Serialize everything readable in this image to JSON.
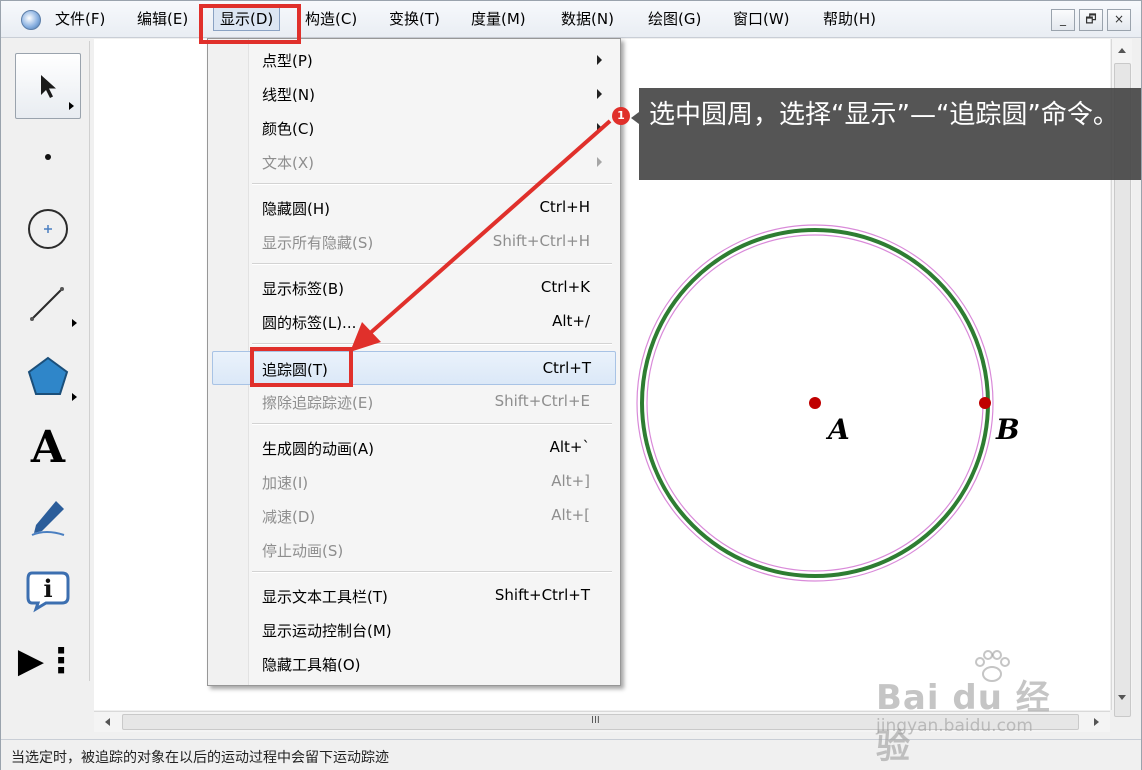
{
  "menubar": {
    "items": [
      "文件(F)",
      "编辑(E)",
      "显示(D)",
      "构造(C)",
      "变换(T)",
      "度量(M)",
      "数据(N)",
      "绘图(G)",
      "窗口(W)",
      "帮助(H)"
    ],
    "window_buttons": [
      "_",
      "🗗",
      "×"
    ]
  },
  "toolbox": {
    "tools": [
      "arrow-tool",
      "point-tool",
      "compass-tool",
      "straightedge-tool",
      "polygon-tool",
      "text-tool",
      "marker-tool",
      "information-tool",
      "custom-tool"
    ],
    "text_tool_glyph": "A",
    "info_tool_glyph": "i",
    "custom_tool_glyph": "▶⋮"
  },
  "dropdown": {
    "items": [
      {
        "label": "点型(P)",
        "shortcut": "",
        "submenu": true,
        "disabled": false
      },
      {
        "label": "线型(N)",
        "shortcut": "",
        "submenu": true,
        "disabled": false
      },
      {
        "label": "颜色(C)",
        "shortcut": "",
        "submenu": true,
        "disabled": false
      },
      {
        "label": "文本(X)",
        "shortcut": "",
        "submenu": true,
        "disabled": true
      },
      {
        "label": "隐藏圆(H)",
        "shortcut": "Ctrl+H",
        "submenu": false,
        "disabled": false
      },
      {
        "label": "显示所有隐藏(S)",
        "shortcut": "Shift+Ctrl+H",
        "submenu": false,
        "disabled": true
      },
      {
        "label": "显示标签(B)",
        "shortcut": "Ctrl+K",
        "submenu": false,
        "disabled": false
      },
      {
        "label": "圆的标签(L)...",
        "shortcut": "Alt+/",
        "submenu": false,
        "disabled": false
      },
      {
        "label": "追踪圆(T)",
        "shortcut": "Ctrl+T",
        "submenu": false,
        "disabled": false,
        "highlighted": true
      },
      {
        "label": "擦除追踪踪迹(E)",
        "shortcut": "Shift+Ctrl+E",
        "submenu": false,
        "disabled": true
      },
      {
        "label": "生成圆的动画(A)",
        "shortcut": "Alt+`",
        "submenu": false,
        "disabled": false
      },
      {
        "label": "加速(I)",
        "shortcut": "Alt+]",
        "submenu": false,
        "disabled": true
      },
      {
        "label": "减速(D)",
        "shortcut": "Alt+[",
        "submenu": false,
        "disabled": true
      },
      {
        "label": "停止动画(S)",
        "shortcut": "",
        "submenu": false,
        "disabled": true
      },
      {
        "label": "显示文本工具栏(T)",
        "shortcut": "Shift+Ctrl+T",
        "submenu": false,
        "disabled": false
      },
      {
        "label": "显示运动控制台(M)",
        "shortcut": "",
        "submenu": false,
        "disabled": false
      },
      {
        "label": "隐藏工具箱(O)",
        "shortcut": "",
        "submenu": false,
        "disabled": false
      }
    ]
  },
  "canvas": {
    "point_a_label": "A",
    "point_b_label": "B",
    "circle_color": "#2e7d32",
    "circle_trace_color": "#d98ad9",
    "point_color": "#c00000"
  },
  "callout": {
    "number": "1",
    "text": "选中圆周，选择“显示”—“追踪圆”命令。"
  },
  "hscroll_grip": "III",
  "statusbar": {
    "text": "当选定时，被追踪的对象在以后的运动过程中会留下运动踪迹"
  },
  "watermark": {
    "brand": "Bai du 经验",
    "url": "jingyan.baidu.com"
  },
  "colors": {
    "accent_red": "#e0302b",
    "callout_bg": "#464646"
  }
}
